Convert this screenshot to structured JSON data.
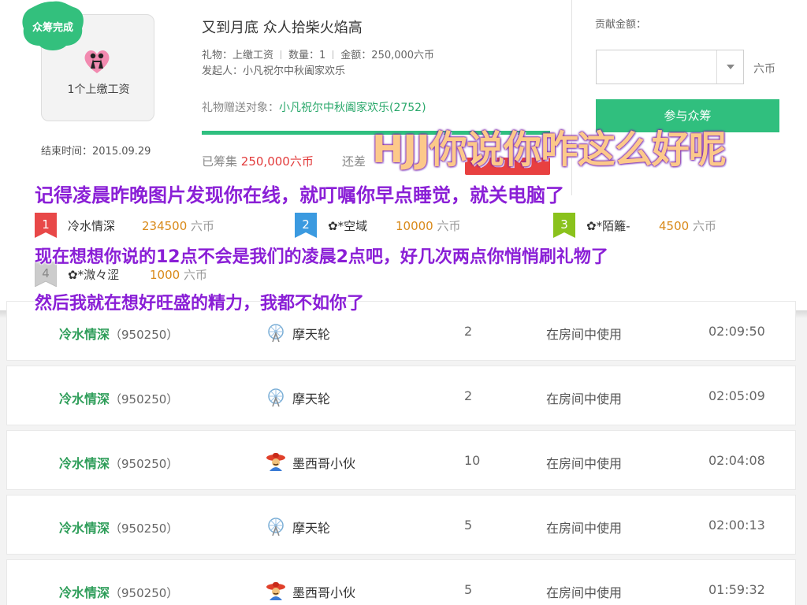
{
  "card": {
    "badge": "众筹完成",
    "gift_label": "1个上缴工资",
    "end_time": "结束时间：2015.09.29",
    "title": "又到月底 众人拾柴火焰高",
    "gift_name": "礼物：上缴工资",
    "quantity": "数量：1",
    "amount": "金额：250,000六币",
    "initiator": "发起人：小凡祝尔中秋阖家欢乐",
    "target_label": "礼物赠送对象：",
    "target_name": "小凡祝尔中秋阖家欢乐(2752)",
    "progress": 1.0,
    "raised_label": "已筹集",
    "raised_amount": "250,000六币",
    "remaining": "还差",
    "contrib_label": "贡献金额：",
    "contrib_unit": "六币",
    "join_button": "参与众筹"
  },
  "ranking": [
    {
      "rank": "1",
      "name": "冷水情深",
      "amount": "234500",
      "unit": "六币",
      "color": "#e84848"
    },
    {
      "rank": "2",
      "name": "✿*空域",
      "amount": "10000",
      "unit": "六币",
      "color": "#3b9ae0"
    },
    {
      "rank": "3",
      "name": "✿*陌籬-",
      "amount": "4500",
      "unit": "六币",
      "color": "#8ac21c"
    },
    {
      "rank": "4",
      "name": "✿*溦々涩",
      "amount": "1000",
      "unit": "六币",
      "color": "#cccccc"
    }
  ],
  "captions": {
    "orange": "HJJ你说你咋这么好呢",
    "line1": "记得凌晨昨晚图片发现你在线，就叮嘱你早点睡觉，就关电脑了",
    "line2": "现在想想你说的12点不会是我们的凌晨2点吧，好几次两点你悄悄刷礼物了",
    "line3": "然后我就在想好旺盛的精力，我都不如你了"
  },
  "records": [
    {
      "user": "冷水情深",
      "uid": "（950250）",
      "gift": "摩天轮",
      "gift_icon": "ferris-wheel",
      "count": "2",
      "status": "在房间中使用",
      "time": "02:09:50"
    },
    {
      "user": "冷水情深",
      "uid": "（950250）",
      "gift": "摩天轮",
      "gift_icon": "ferris-wheel",
      "count": "2",
      "status": "在房间中使用",
      "time": "02:05:09"
    },
    {
      "user": "冷水情深",
      "uid": "（950250）",
      "gift": "墨西哥小伙",
      "gift_icon": "mexican-guy",
      "count": "10",
      "status": "在房间中使用",
      "time": "02:04:08"
    },
    {
      "user": "冷水情深",
      "uid": "（950250）",
      "gift": "摩天轮",
      "gift_icon": "ferris-wheel",
      "count": "5",
      "status": "在房间中使用",
      "time": "02:00:13"
    },
    {
      "user": "冷水情深",
      "uid": "（950250）",
      "gift": "墨西哥小伙",
      "gift_icon": "mexican-guy",
      "count": "5",
      "status": "在房间中使用",
      "time": "01:59:32"
    }
  ]
}
